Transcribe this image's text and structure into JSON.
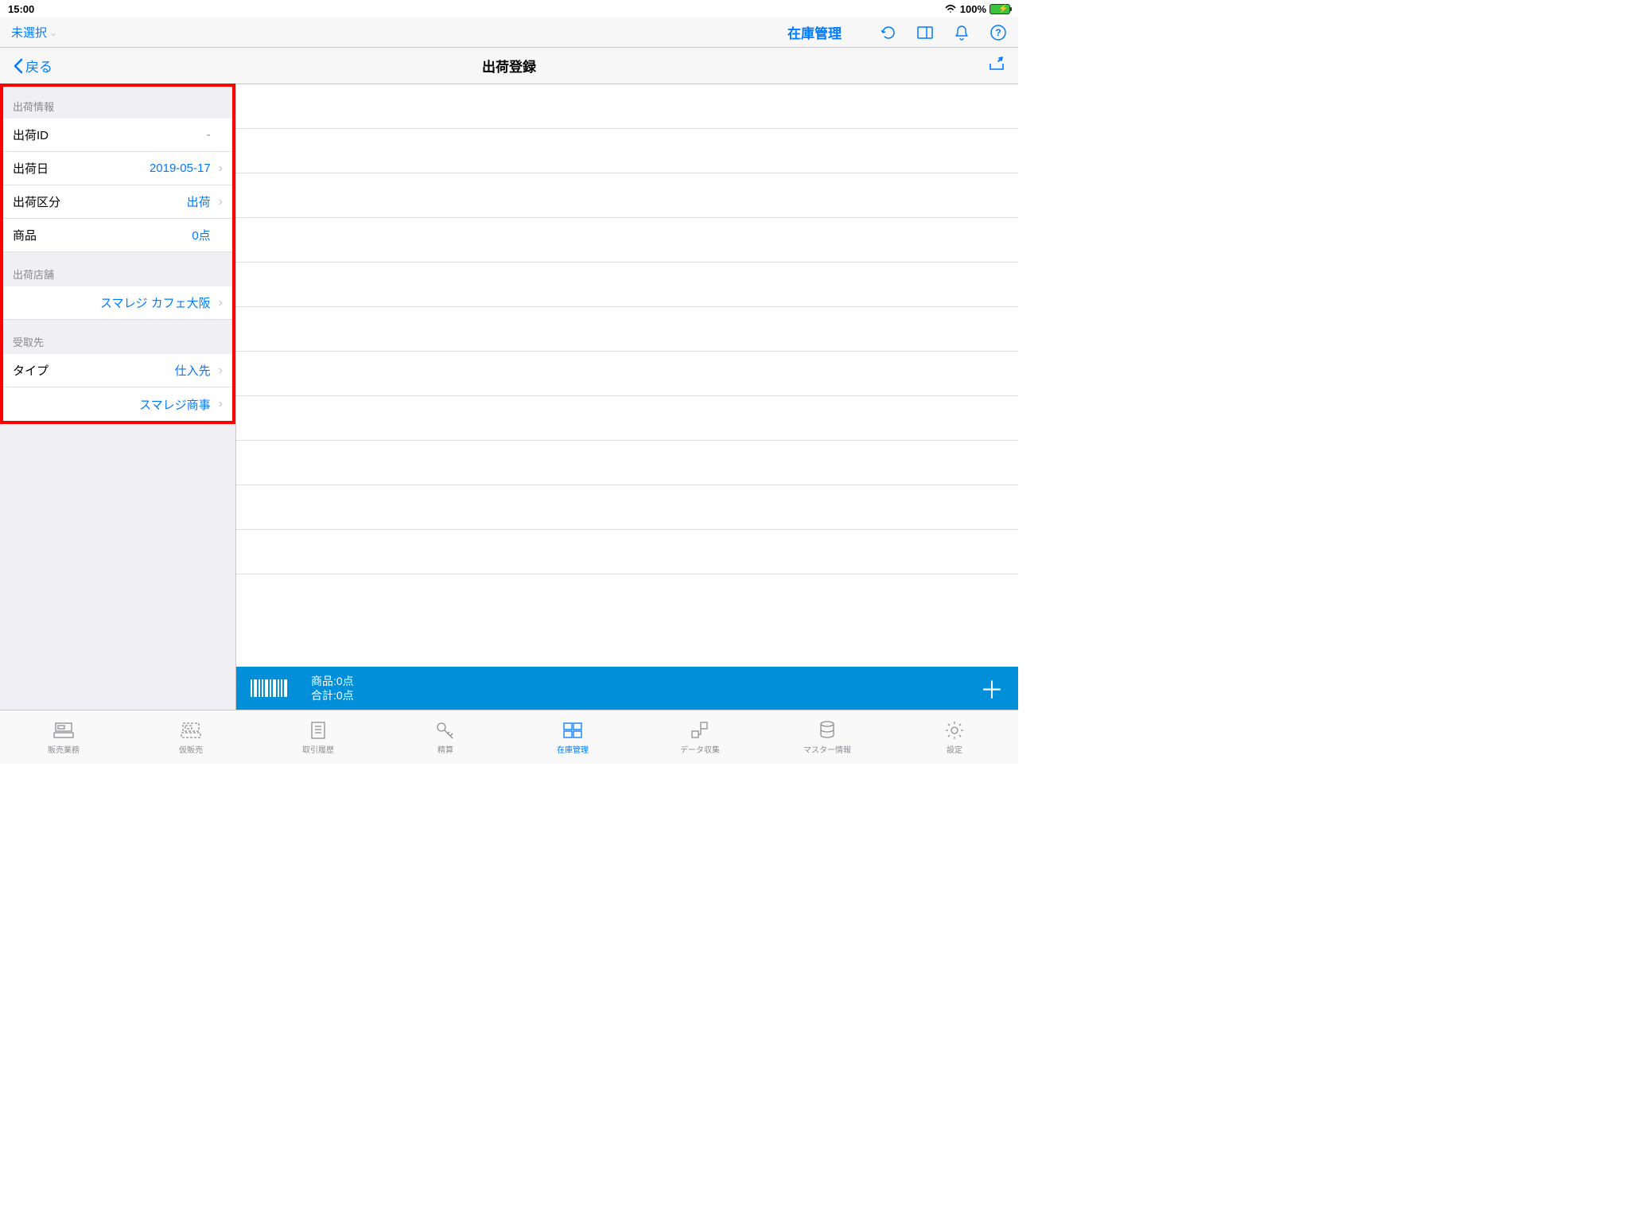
{
  "status": {
    "time": "15:00",
    "battery": "100%"
  },
  "nav1": {
    "selector": "未選択",
    "title": "在庫管理"
  },
  "nav2": {
    "back": "戻る",
    "title": "出荷登録"
  },
  "sections": {
    "shipInfo": {
      "header": "出荷情報",
      "rows": {
        "id": {
          "label": "出荷ID",
          "value": "-"
        },
        "date": {
          "label": "出荷日",
          "value": "2019-05-17"
        },
        "type": {
          "label": "出荷区分",
          "value": "出荷"
        },
        "item": {
          "label": "商品",
          "value": "0点"
        }
      }
    },
    "shipStore": {
      "header": "出荷店舗",
      "value": "スマレジ カフェ大阪"
    },
    "recipient": {
      "header": "受取先",
      "typeLabel": "タイプ",
      "typeValue": "仕入先",
      "value": "スマレジ商事"
    }
  },
  "summary": {
    "line1": "商品:0点",
    "line2": "合計:0点"
  },
  "tabs": [
    "販売業務",
    "仮販売",
    "取引履歴",
    "精算",
    "在庫管理",
    "データ収集",
    "マスター情報",
    "設定"
  ]
}
